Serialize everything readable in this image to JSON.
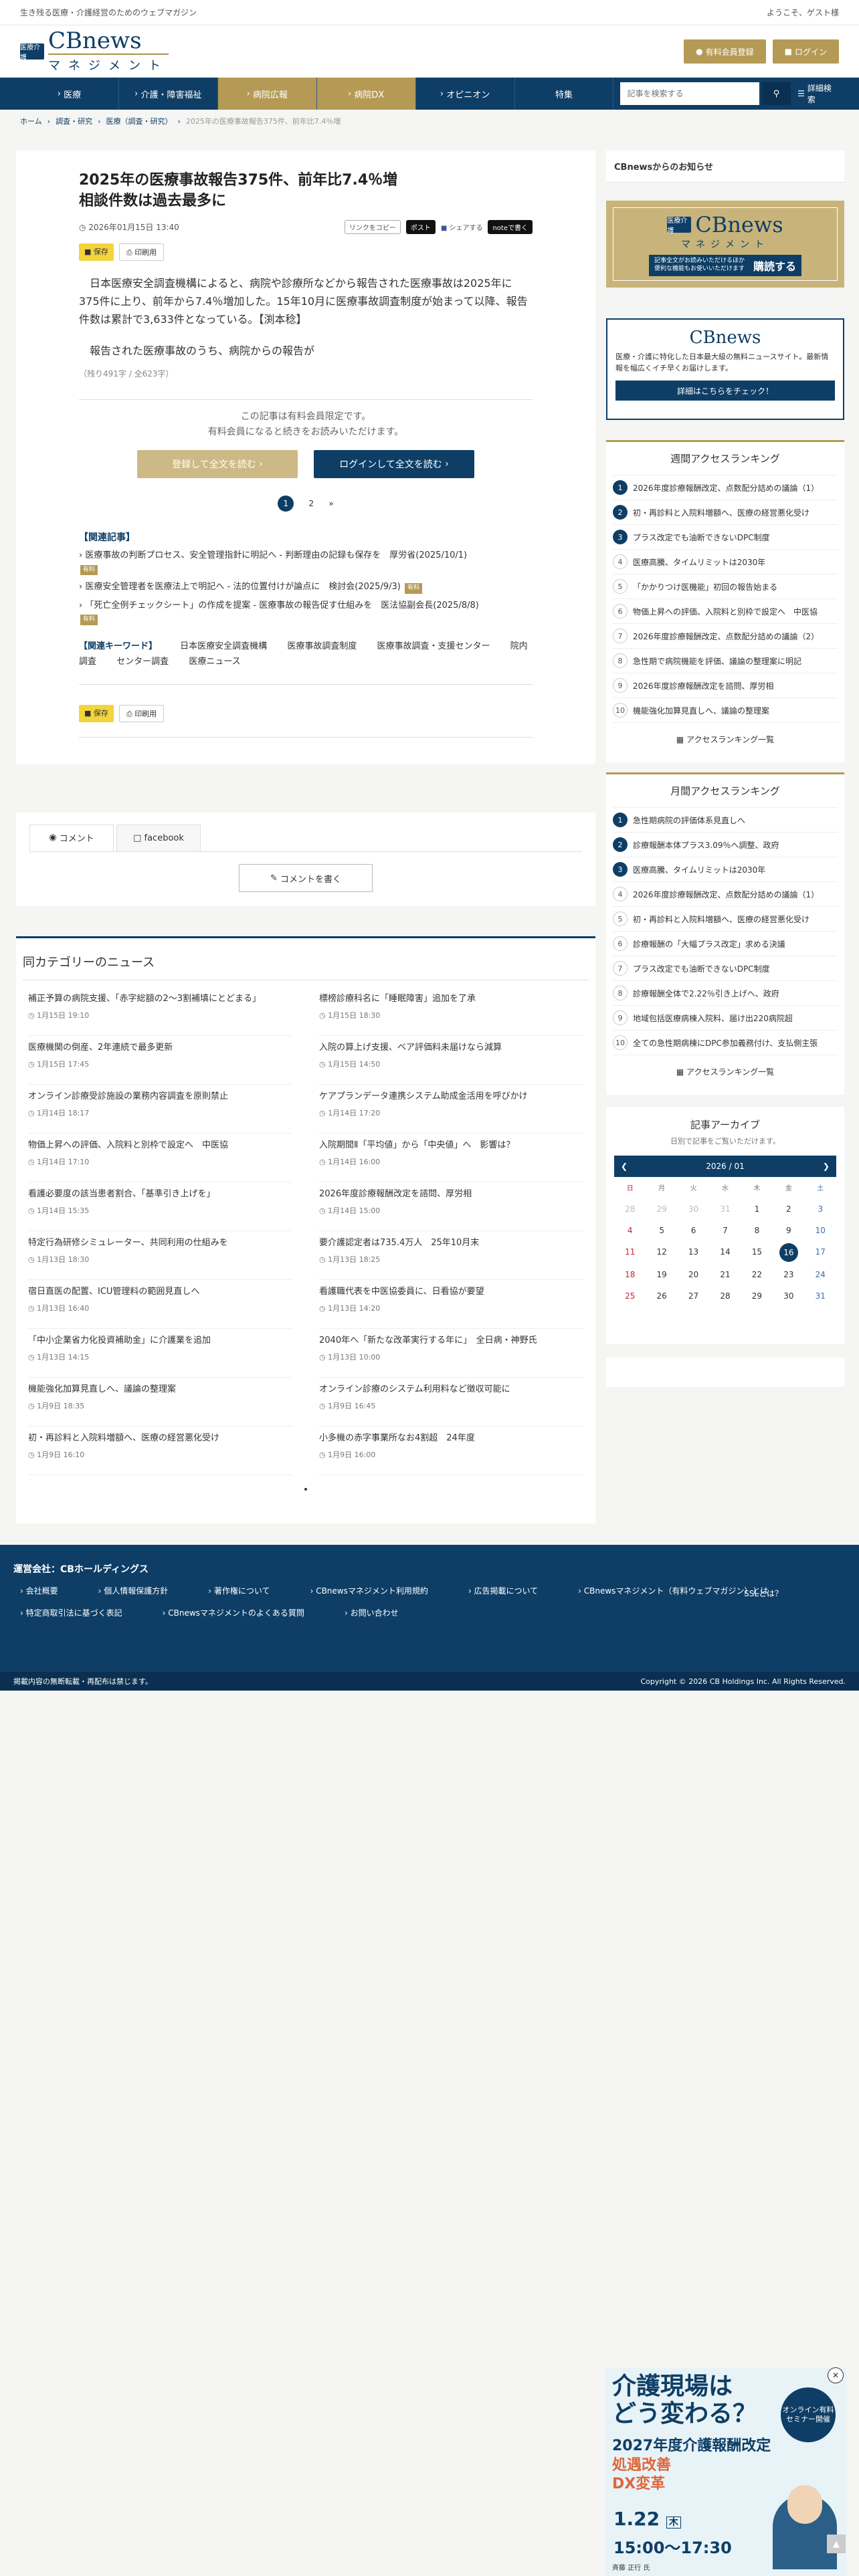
{
  "top": {
    "tagline": "生き残る医療・介護経営のためのウェブマガジン",
    "welcome": "ようこそ、ゲスト様"
  },
  "logo": {
    "badge": "医療介護",
    "name": "CBnews",
    "sub": "マネジメント"
  },
  "header": {
    "register": "有料会員登録",
    "login": "ログイン"
  },
  "nav": {
    "items": [
      "医療",
      "介護・障害福祉",
      "病院広報",
      "病院DX",
      "オピニオン",
      "特集"
    ],
    "search_placeholder": "記事を検索する",
    "advanced": "詳細検索"
  },
  "breadcrumb": [
    "ホーム",
    "調査・研究",
    "医療（調査・研究）",
    "2025年の医療事故報告375件、前年比7.4％増"
  ],
  "article": {
    "title_line1": "2025年の医療事故報告375件、前年比7.4％増",
    "title_line2": "相談件数は過去最多に",
    "date": "2026年01月15日 13:40",
    "copy_link": "リンクをコピー",
    "post": "ポスト",
    "share": "シェアする",
    "note": "noteで書く",
    "save": "保存",
    "print": "印刷用",
    "para1": "日本医療安全調査機構によると、病院や診療所などから報告された医療事故は2025年に375件に上り、前年から7.4％増加した。15年10月に医療事故調査制度が始まって以降、報告件数は累計で3,633件となっている。【渕本稔】",
    "para2": "報告された医療事故のうち、病院からの報告が",
    "remain": "（残り491字 / 全623字）",
    "locked_line1": "この記事は有料会員限定です。",
    "locked_line2": "有料会員になると続きをお読みいただけます。",
    "btn_register": "登録して全文を読む",
    "btn_login": "ログインして全文を読む",
    "pages": [
      "1",
      "2"
    ],
    "related_heading": "【関連記事】",
    "related": [
      {
        "text": "医療事故の判断プロセス、安全管理指針に明記へ - 判断理由の記録も保存を　厚労省(2025/10/1)",
        "badge": "有料"
      },
      {
        "text": "医療安全管理者を医療法上で明記へ - 法的位置付けが論点に　検討会(2025/9/3)",
        "badge": "有料"
      },
      {
        "text": "「死亡全例チェックシート」の作成を提案 - 医療事故の報告促す仕組みを　医法協副会長(2025/8/8)",
        "badge": "有料"
      }
    ],
    "keywords_heading": "【関連キーワード】",
    "keywords": [
      "日本医療安全調査機構",
      "医療事故調査制度",
      "医療事故調査・支援センター",
      "院内調査",
      "センター調査",
      "医療ニュース"
    ]
  },
  "comments": {
    "tab1": "コメント",
    "tab2": "facebook",
    "write": "コメントを書く"
  },
  "same_category": {
    "heading": "同カテゴリーのニュース",
    "items": [
      {
        "t": "補正予算の病院支援、「赤字総額の2～3割補填にとどまる」",
        "d": "1月15日 19:10"
      },
      {
        "t": "標榜診療科名に「睡眠障害」追加を了承",
        "d": "1月15日 18:30"
      },
      {
        "t": "医療機関の倒産、2年連続で最多更新",
        "d": "1月15日 17:45"
      },
      {
        "t": "入院の算上げ支援、ベア評価料未届けなら減算",
        "d": "1月15日 14:50"
      },
      {
        "t": "オンライン診療受診施設の業務内容調査を原則禁止",
        "d": "1月14日 18:17"
      },
      {
        "t": "ケアプランデータ連携システム助成金活用を呼びかけ",
        "d": "1月14日 17:20"
      },
      {
        "t": "物価上昇への評価、入院料と別枠で設定へ　中医協",
        "d": "1月14日 17:10"
      },
      {
        "t": "入院期間Ⅱ「平均値」から「中央値」へ　影響は？",
        "d": "1月14日 16:00"
      },
      {
        "t": "看護必要度の該当患者割合、「基準引き上げを」",
        "d": "1月14日 15:35"
      },
      {
        "t": "2026年度診療報酬改定を諮問、厚労相",
        "d": "1月14日 15:00"
      },
      {
        "t": "特定行為研修シミュレーター、共同利用の仕組みを",
        "d": "1月13日 18:30"
      },
      {
        "t": "要介護認定者は735.4万人　25年10月末",
        "d": "1月13日 18:25"
      },
      {
        "t": "宿日直医の配置、ICU管理料の範囲見直しへ",
        "d": "1月13日 16:40"
      },
      {
        "t": "看護職代表を中医協委員に、日看協が要望",
        "d": "1月13日 14:20"
      },
      {
        "t": "「中小企業省力化投資補助金」に介護業を追加",
        "d": "1月13日 14:15"
      },
      {
        "t": "2040年へ「新たな改革実行する年に」　全日病・神野氏",
        "d": "1月13日 10:00"
      },
      {
        "t": "機能強化加算見直しへ、議論の整理案",
        "d": "1月9日 18:35"
      },
      {
        "t": "オンライン診療のシステム利用料など徴収可能に",
        "d": "1月9日 16:45"
      },
      {
        "t": "初・再診料と入院料増額へ、医療の経営悪化受け",
        "d": "1月9日 16:10"
      },
      {
        "t": "小多機の赤字事業所なお4割超　24年度",
        "d": "1月9日 16:00"
      }
    ]
  },
  "sidebar": {
    "notice_heading": "CBnewsからのお知らせ",
    "ad1": {
      "badge": "医療介護",
      "name": "CBnews",
      "sub": "マネジメント",
      "text": "記事全文がお読みいただけるほか便利な機能もお使いいただけます",
      "cta": "購読する"
    },
    "ad2": {
      "name": "CBnews",
      "text": "医療・介護に特化した日本最大級の無料ニュースサイト。最新情報を幅広くイチ早くお届けします。",
      "cta": "詳細はこちらをチェック！"
    },
    "weekly": {
      "heading": "週間アクセスランキング",
      "items": [
        "2026年度診療報酬改定、点数配分詰めの議論（1）",
        "初・再診料と入院料増額へ、医療の経営悪化受け",
        "プラス改定でも油断できないDPC制度",
        "医療高騰、タイムリミットは2030年",
        "「かかりつけ医機能」初回の報告始まる",
        "物価上昇への評価、入院料と別枠で設定へ　中医協",
        "2026年度診療報酬改定、点数配分詰めの議論（2）",
        "急性期で病院機能を評価、議論の整理案に明記",
        "2026年度診療報酬改定を諮問、厚労相",
        "機能強化加算見直しへ、議論の整理案"
      ],
      "more": "アクセスランキング一覧"
    },
    "monthly": {
      "heading": "月間アクセスランキング",
      "items": [
        "急性期病院の評価体系見直しへ",
        "診療報酬本体プラス3.09％へ調整、政府",
        "医療高騰、タイムリミットは2030年",
        "2026年度診療報酬改定、点数配分詰めの議論（1）",
        "初・再診料と入院料増額へ、医療の経営悪化受け",
        "診療報酬の「大幅プラス改定」求める決議",
        "プラス改定でも油断できないDPC制度",
        "診療報酬全体で2.22％引き上げへ、政府",
        "地域包括医療病棟入院料、届け出220病院超",
        "全ての急性期病棟にDPC参加義務付け、支払側主張"
      ],
      "more": "アクセスランキング一覧"
    },
    "archive": {
      "heading": "記事アーカイブ",
      "sub": "日別で記事をご覧いただけます。",
      "month": "2026 / 01",
      "weekdays": [
        "日",
        "月",
        "火",
        "水",
        "木",
        "金",
        "土"
      ],
      "days": [
        [
          "28",
          "29",
          "30",
          "31",
          "1",
          "2",
          "3"
        ],
        [
          "4",
          "5",
          "6",
          "7",
          "8",
          "9",
          "10"
        ],
        [
          "11",
          "12",
          "13",
          "14",
          "15",
          "16",
          "17"
        ],
        [
          "18",
          "19",
          "20",
          "21",
          "22",
          "23",
          "24"
        ],
        [
          "25",
          "26",
          "27",
          "28",
          "29",
          "30",
          "31"
        ]
      ]
    }
  },
  "footer": {
    "company": "運営会社：CBホールディングス",
    "links": [
      "会社概要",
      "個人情報保護方針",
      "著作権について",
      "CBnewsマネジメント利用規約",
      "広告掲載について",
      "CBnewsマネジメント（有料ウェブマガジン）とは",
      "特定商取引法に基づく表記",
      "CBnewsマネジメントのよくある質問",
      "お問い合わせ"
    ],
    "ssl": "SSLとは？",
    "notice": "掲載内容の無断転載・再配布は禁じます。",
    "copyright": "Copyright © 2026 CB Holdings Inc. All Rights Reserved."
  },
  "banner": {
    "headline1": "介護現場は",
    "headline2": "どう変わる？",
    "tag": "オンライン有料セミナー開催",
    "sub1": "2027年度介護報酬改定",
    "sub2": "処遇改善",
    "sub3": "DX変革",
    "date": "1.22",
    "dow": "木",
    "time": "15:00〜17:30",
    "speaker": "斉藤 正行 氏"
  },
  "colors": {
    "navy": "#0e3e66",
    "gold": "#b59a55",
    "accent": "#e0663a"
  }
}
